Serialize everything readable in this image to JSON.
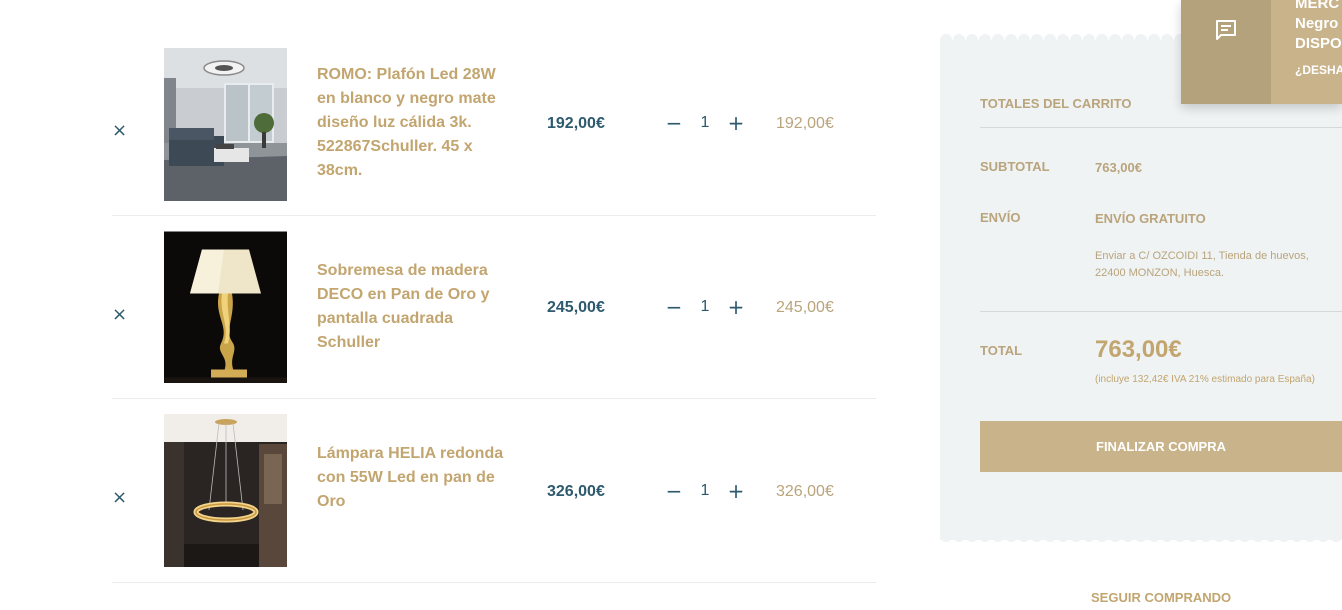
{
  "cart": {
    "remove_symbol": "×",
    "minus_symbol": "−",
    "plus_symbol": "+",
    "items": [
      {
        "name": "ROMO: Plafón Led 28W en blanco y negro mate diseño luz cálida 3k. 522867Schuller. 45 x 38cm.",
        "price": "192,00€",
        "quantity": "1",
        "subtotal": "192,00€",
        "image": "living-room-ceiling-lamp"
      },
      {
        "name": "Sobremesa de madera DECO en Pan de Oro y pantalla cuadrada Schuller",
        "price": "245,00€",
        "quantity": "1",
        "subtotal": "245,00€",
        "image": "gold-table-lamp"
      },
      {
        "name": "Lámpara HELIA redonda con 55W Led en pan de Oro",
        "price": "326,00€",
        "quantity": "1",
        "subtotal": "326,00€",
        "image": "ring-pendant-lamp"
      }
    ]
  },
  "totals": {
    "heading": "TOTALES DEL CARRITO",
    "subtotal_label": "SUBTOTAL",
    "subtotal_value": "763,00€",
    "shipping_label": "ENVÍO",
    "shipping_value": "ENVÍO GRATUITO",
    "shipping_address": "Enviar a C/ OZCOIDI 11, Tienda de huevos, 22400 MONZON, Huesca.",
    "total_label": "TOTAL",
    "total_value": "763,00€",
    "tax_note": "(incluye 132,42€ IVA 21% estimado para España)",
    "checkout_label": "FINALIZAR COMPRA",
    "continue_label": "SEGUIR COMPRANDO"
  },
  "notice": {
    "icon": "message-icon",
    "lines": [
      "MERC",
      "Negro",
      "DISPO"
    ],
    "undo": "¿DESHA"
  },
  "colors": {
    "gold": "#c2a56f",
    "teal": "#2e5a6e",
    "panel_bg": "#eff3f3",
    "button_bg": "#c9b38a"
  }
}
